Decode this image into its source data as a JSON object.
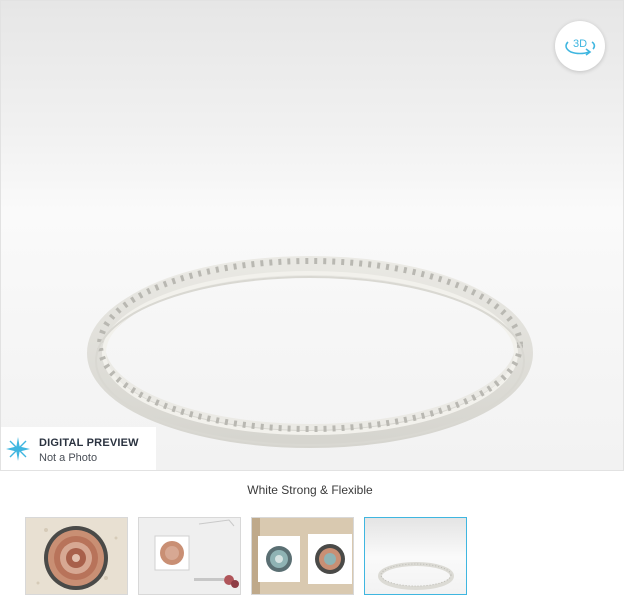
{
  "viewer": {
    "badge_title": "DIGITAL PREVIEW",
    "badge_subtitle": "Not a Photo",
    "view_3d_label": "3D",
    "accent_color": "#3fb6e0"
  },
  "material_label": "White Strong & Flexible",
  "thumbnails": [
    {
      "name": "photo-1",
      "active": false
    },
    {
      "name": "photo-2",
      "active": false
    },
    {
      "name": "photo-3",
      "active": false
    },
    {
      "name": "render",
      "active": true
    }
  ]
}
